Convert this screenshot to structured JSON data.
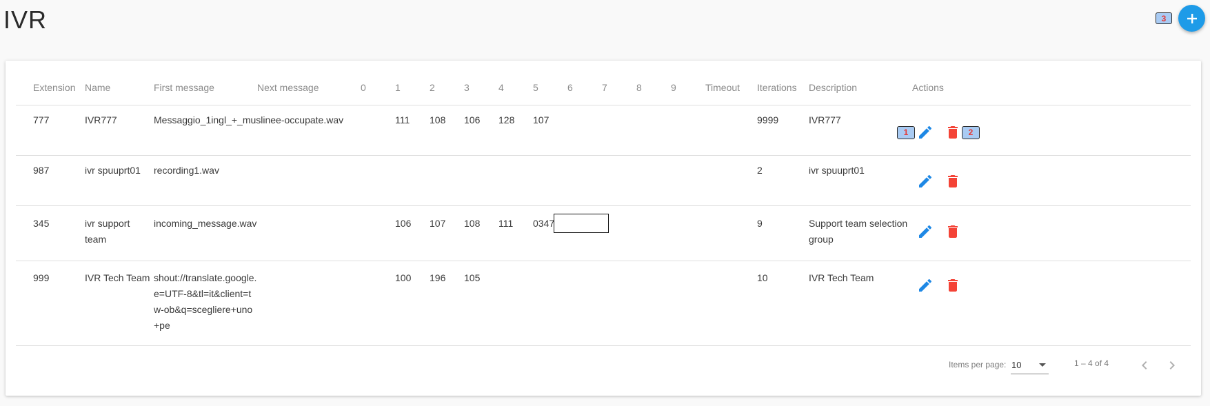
{
  "page": {
    "title": "IVR"
  },
  "badges": {
    "b1": "1",
    "b2": "2",
    "b3": "3"
  },
  "colors": {
    "accent": "#1e9be8",
    "danger": "#f44336",
    "badge_bg": "#a9cbf3",
    "badge_text": "#e53935"
  },
  "toolbar": {
    "add_icon": "plus-icon"
  },
  "table": {
    "headers": {
      "extension": "Extension",
      "name": "Name",
      "first_message": "First message",
      "next_message": "Next message",
      "k0": "0",
      "k1": "1",
      "k2": "2",
      "k3": "3",
      "k4": "4",
      "k5": "5",
      "k6": "6",
      "k7": "7",
      "k8": "8",
      "k9": "9",
      "timeout": "Timeout",
      "iterations": "Iterations",
      "description": "Description",
      "actions": "Actions"
    },
    "rows": [
      {
        "extension": "777",
        "name": "IVR777",
        "first_message": "Messaggio_1ingl_+_muslinee-occupate.wav",
        "k1": "111",
        "k2": "108",
        "k3": "106",
        "k4": "128",
        "k5": "107",
        "iterations": "9999",
        "description": "IVR777"
      },
      {
        "extension": "987",
        "name": "ivr spuuprt01",
        "first_message": "recording1.wav",
        "iterations": "2",
        "description": "ivr spuuprt01"
      },
      {
        "extension": "345",
        "name": "ivr support team",
        "first_message": "incoming_message.wav",
        "k1": "106",
        "k2": "107",
        "k3": "108",
        "k4": "111",
        "k5": "0347",
        "iterations": "9",
        "description": "Support team selection group"
      },
      {
        "extension": "999",
        "name": "IVR Tech Team",
        "first_message": "shout://translate.google.e=UTF-8&tl=it&client=tw-ob&q=scegliere+uno+pe",
        "k1": "100",
        "k2": "196",
        "k3": "105",
        "iterations": "10",
        "description": "IVR Tech Team"
      }
    ],
    "icons": {
      "edit": "pencil-icon",
      "delete": "trash-icon"
    }
  },
  "paginator": {
    "items_per_page_label": "Items per page:",
    "page_size": "10",
    "range_label": "1 – 4 of 4",
    "prev_icon": "chevron-left-icon",
    "next_icon": "chevron-right-icon"
  }
}
